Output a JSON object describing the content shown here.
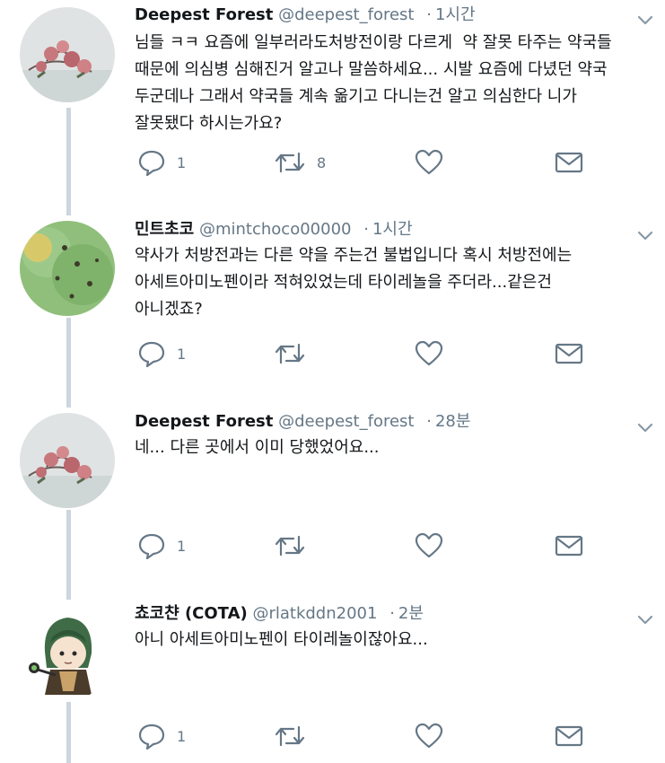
{
  "tweets": [
    {
      "name": "Deepest Forest",
      "handle": "@deepest_forest",
      "time": "1시간",
      "text": "님들 ㅋㅋ 요즘에 일부러라도처방전이랑 다르게  약 잘못 타주는 약국들\n때문에 의심병 심해진거 알고나 말씀하세요... 시발 요즘에 다녔던 약국\n두군데나 그래서 약국들 계속 옮기고 다니는건 알고 의심한다 니가\n잘못됐다 하시는가요?",
      "replies": "1",
      "retweets": "8",
      "avatar": "flower-avatar"
    },
    {
      "name": "민트초코",
      "handle": "@mintchoco00000",
      "time": "1시간",
      "text": "약사가 처방전과는 다른 약을 주는건 불법입니다 혹시 처방전에는\n아세트아미노펜이라 적혀있었는데 타이레놀을 주더라...같은건\n아니겠죠?",
      "replies": "1",
      "retweets": "",
      "avatar": "mint-avatar"
    },
    {
      "name": "Deepest Forest",
      "handle": "@deepest_forest",
      "time": "28분",
      "text": "네... 다른 곳에서 이미 당했었어요...",
      "replies": "1",
      "retweets": "",
      "avatar": "flower-avatar"
    },
    {
      "name": "쵸코챤 (COTA)",
      "handle": "@rlatkddn2001",
      "time": "2분",
      "text": "아니 아세트아미노펜이 타이레놀이잖아요...",
      "replies": "1",
      "retweets": "",
      "avatar": "anime-avatar"
    }
  ],
  "colors": {
    "text": "#14171a",
    "secondary": "#657786",
    "icon": "#657786",
    "thread_line": "#ccd6dd"
  }
}
